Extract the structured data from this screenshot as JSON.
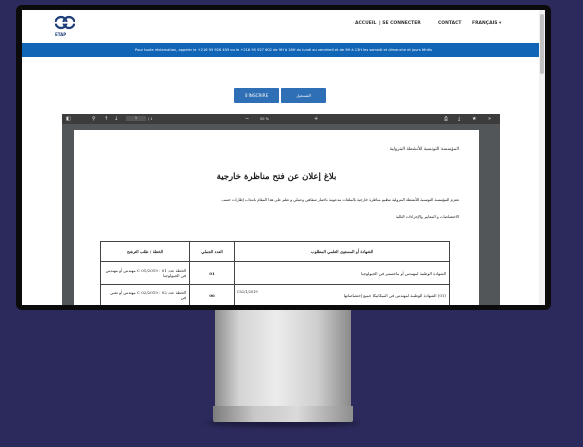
{
  "brand": {
    "logo_text": "ETAP"
  },
  "nav": {
    "accueil": "ACCUEIL",
    "connect": "| SE CONNECTER",
    "contact": "CONTACT",
    "lang": "FRANÇAIS ▾"
  },
  "banner": {
    "text": "Pour toute réclamation, appeler le +216 95 926 459 ou le +216 95 927 602 de 9H à 16H du lundi au vendredi et de 9H à 13H les samedi et dimanche et jours fériés"
  },
  "buttons": {
    "subscribe": "S'INSCRIRE",
    "arabic": "التسجيل"
  },
  "toolbar": {
    "sidebar": "◧",
    "search": "⚲",
    "up": "↑",
    "down": "↓",
    "page": "1",
    "of": "/ 1",
    "minus": "−",
    "plus": "+",
    "zoom": "50 %",
    "print": "⎙",
    "download": "⤓",
    "bookmark": "★",
    "more": "»"
  },
  "doc": {
    "org": "المؤسسة التونسية للأنشطة البترولية",
    "title": "بلاغ إعلان عن فتح مناظرة خارجية",
    "para1": "تعتزم المؤسسة التونسية للأنشطة البترولية تنظيم مناظرة خارجية بالملفات مدعومة باختبار شفاهي وعملي و تعلم على هذا المقام بانتداب إطارات حسب",
    "para2": "الاختصاصات و المعايير والإجراءات التالية",
    "headers": {
      "spec": "الخطة / طلب الترشح",
      "num": "العدد الجملي",
      "diploma": "الشهادة أو المستوى العلمي المطلوب"
    },
    "rows": [
      {
        "spec": "الخطة عدد 01 : 2019/C 01 مهندس أو مهندس في الجيولوجيا",
        "num": "01",
        "diploma": "الشهادة الوطنية لمهندس أو ماجستير في الجيولوجيا",
        "code": ""
      },
      {
        "spec": "الخطة عدد 02 : 2019/C 02 مهندس أو تقني في",
        "num": "06",
        "diploma": "(01) الشهادة الوطنية لمهندس في الميكانيكا جميع إختصاصاتها",
        "code": "C02/1/2019"
      },
      {
        "spec": "",
        "num": "",
        "diploma": "",
        "code": ""
      }
    ]
  },
  "colors": {
    "banner": "#1165b7",
    "button": "#2f6fb5",
    "background": "#2c2a5c",
    "brand": "#1f3f7a"
  }
}
